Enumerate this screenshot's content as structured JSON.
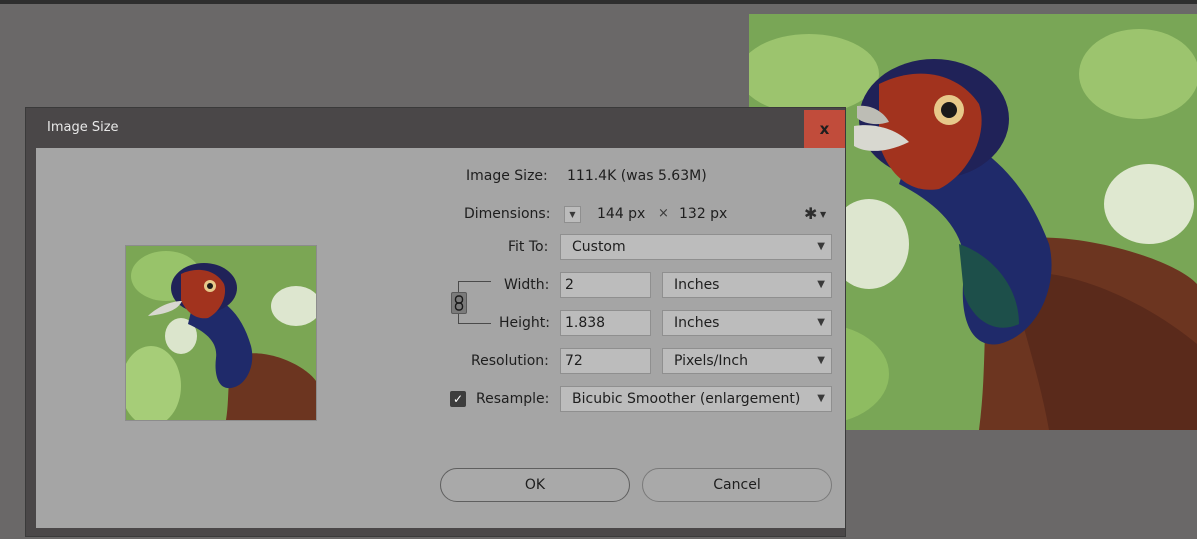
{
  "dialog": {
    "title": "Image Size",
    "close_label": "x"
  },
  "info": {
    "image_size_label": "Image Size:",
    "image_size_value": "111.4K (was 5.63M)",
    "dimensions_label": "Dimensions:",
    "dimensions_width": "144 px",
    "dimensions_sep": "×",
    "dimensions_height": "132 px"
  },
  "fit_to": {
    "label": "Fit To:",
    "selected": "Custom"
  },
  "width": {
    "label": "Width:",
    "value": "2",
    "unit": "Inches"
  },
  "height": {
    "label": "Height:",
    "value": "1.838",
    "unit": "Inches"
  },
  "resolution": {
    "label": "Resolution:",
    "value": "72",
    "unit": "Pixels/Inch"
  },
  "resample": {
    "label": "Resample:",
    "checked": true,
    "selected": "Bicubic Smoother (enlargement)"
  },
  "buttons": {
    "ok": "OK",
    "cancel": "Cancel"
  },
  "icons": {
    "settings": "gear-icon",
    "link": "link-chain-icon",
    "close": "close-icon",
    "dropdown": "chevron-down-icon"
  },
  "colors": {
    "workspace": "#6a6868",
    "dialog_frame": "#4a4748",
    "dialog_body": "#a5a5a5",
    "close_button": "#c14c3b",
    "field_bg": "#bcbcbc"
  }
}
